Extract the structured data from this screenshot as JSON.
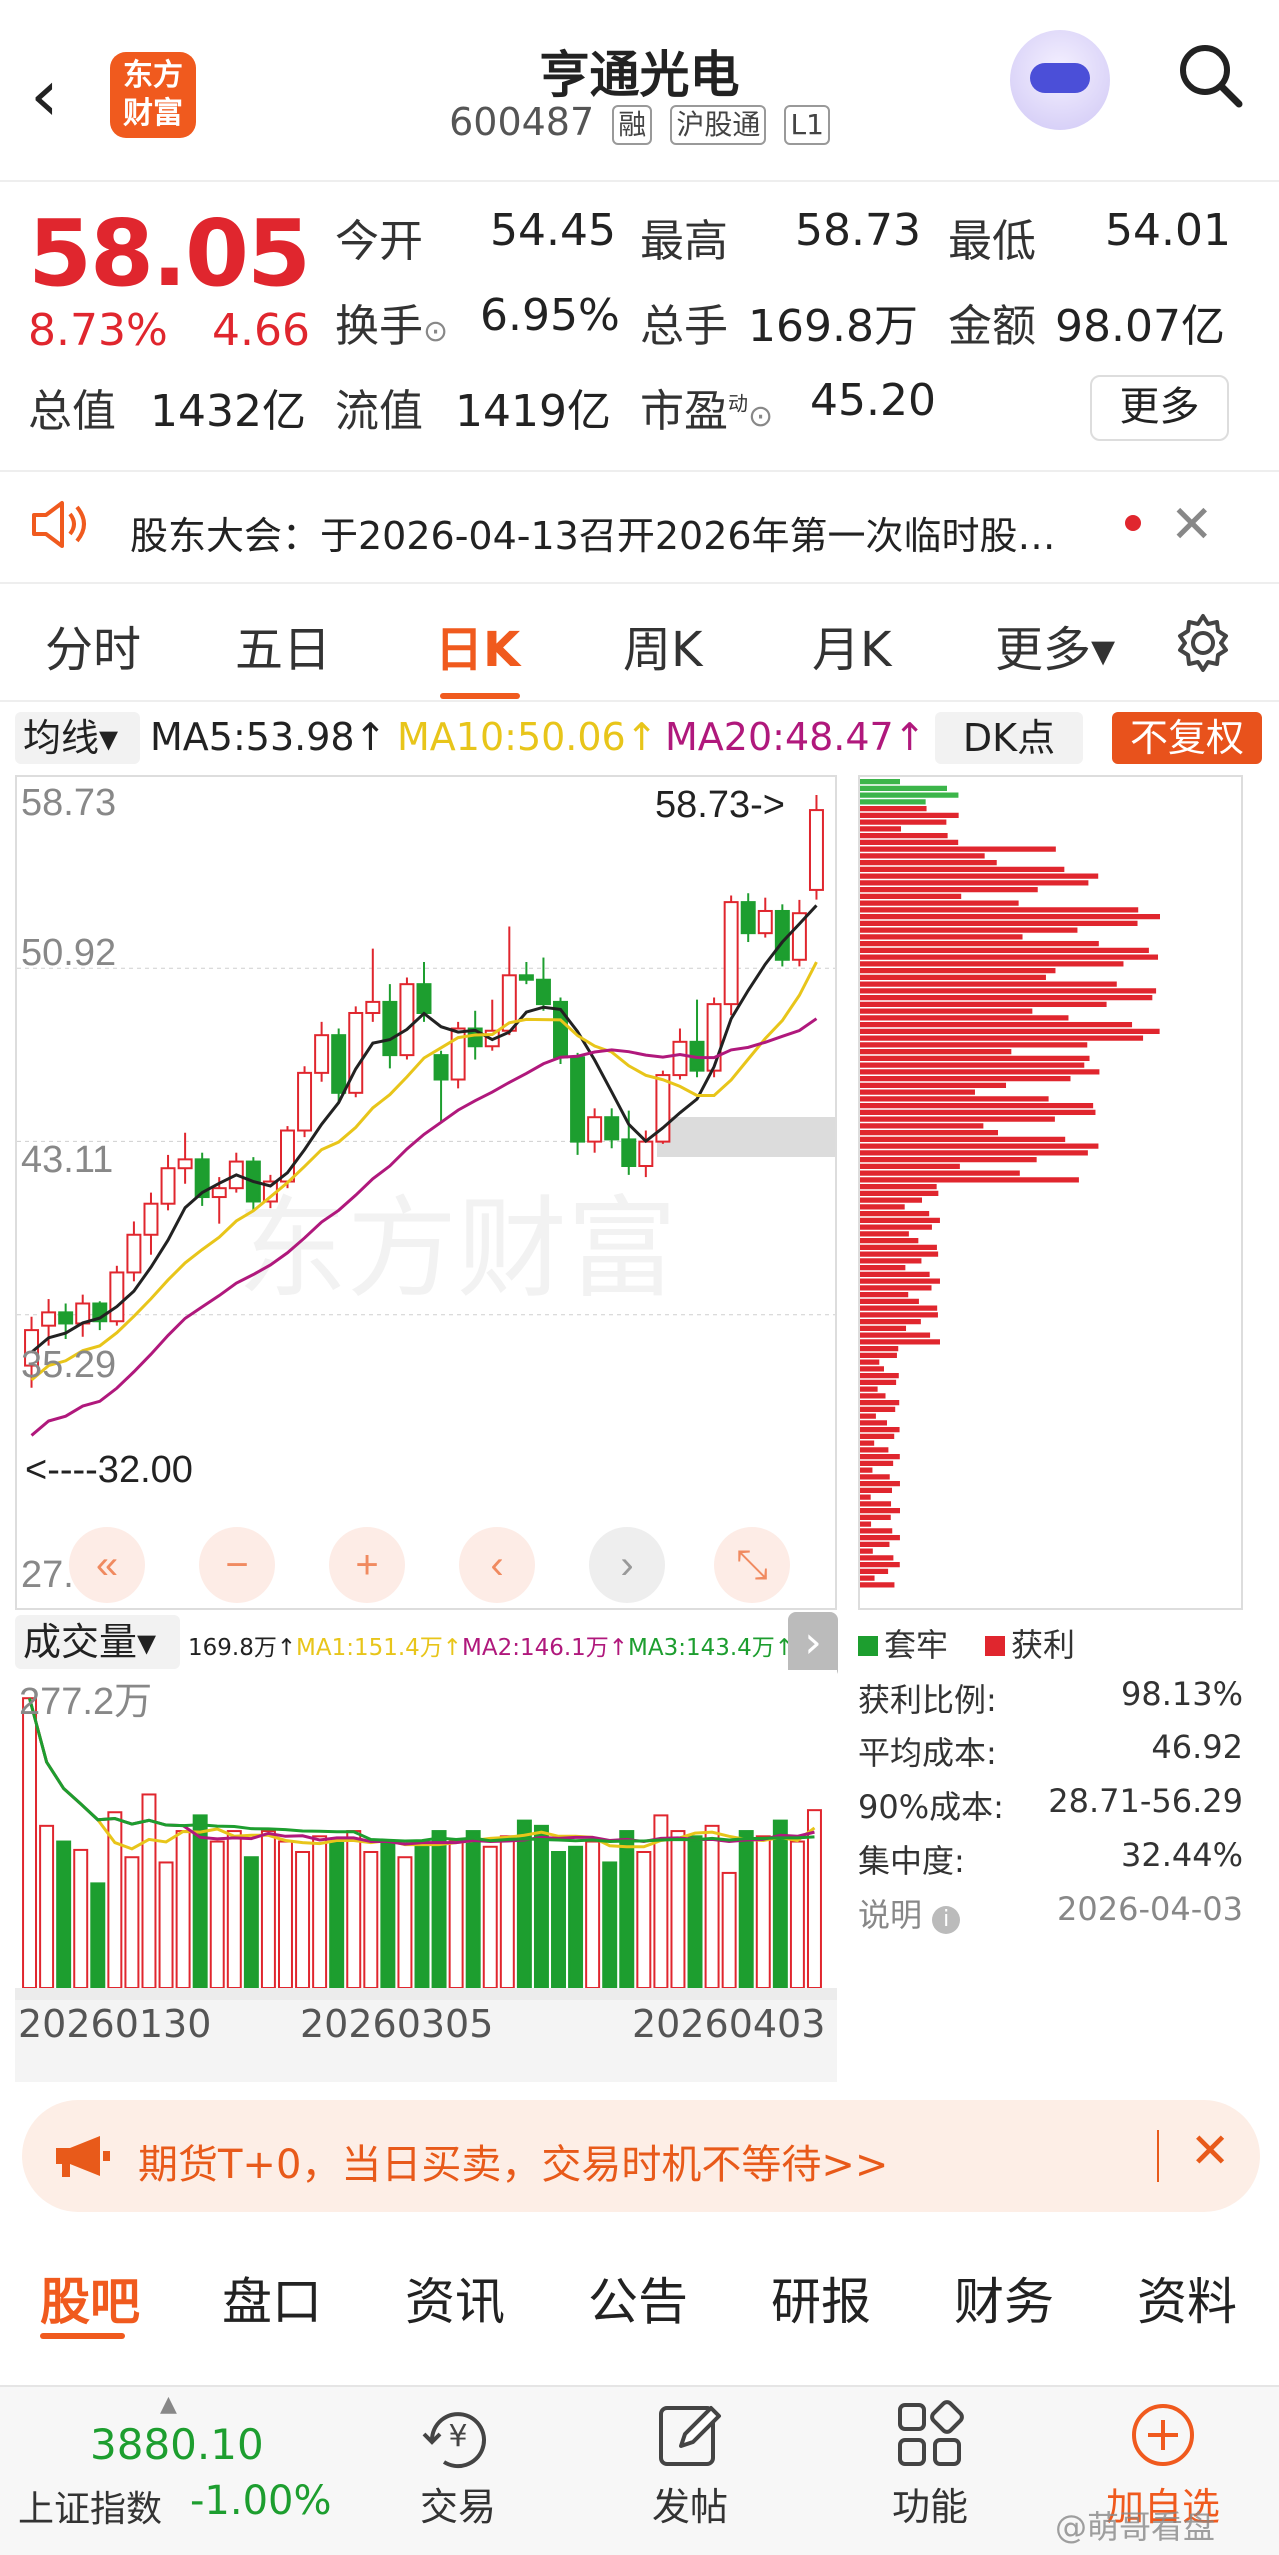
{
  "header": {
    "back_icon": "chevron-left-icon",
    "logo_line1": "东方",
    "logo_line2": "财富",
    "title": "亨通光电",
    "code": "600487",
    "tags": [
      "融",
      "沪股通",
      "L1"
    ],
    "avatar_icon": "robot-avatar-icon",
    "search_icon": "search-icon"
  },
  "quote": {
    "price": "58.05",
    "change_pct": "8.73%",
    "change": "4.66",
    "open_label": "今开",
    "open": "54.45",
    "high_label": "最高",
    "high": "58.73",
    "low_label": "最低",
    "low": "54.01",
    "turnover_label": "换手",
    "turnover": "6.95%",
    "volume_label": "总手",
    "volume": "169.8万",
    "amount_label": "金额",
    "amount": "98.07亿",
    "mktcap_label": "总值",
    "mktcap": "1432亿",
    "float_label": "流值",
    "float": "1419亿",
    "pe_label": "市盈",
    "pe_sup": "动",
    "pe": "45.20",
    "more_label": "更多"
  },
  "notice": {
    "speaker_icon": "speaker-icon",
    "text": "股东大会：于2026-04-13召开2026年第一次临时股…",
    "close_icon": "close-icon"
  },
  "period_tabs": [
    {
      "label": "分时",
      "active": false
    },
    {
      "label": "五日",
      "active": false
    },
    {
      "label": "日K",
      "active": true
    },
    {
      "label": "周K",
      "active": false
    },
    {
      "label": "月K",
      "active": false
    },
    {
      "label": "更多▾",
      "active": false
    }
  ],
  "settings_icon": "gear-icon",
  "ma": {
    "selector": "均线▾",
    "ma5": "MA5:53.98↑",
    "ma10": "MA10:50.06↑",
    "ma20": "MA20:48.47↑",
    "dk": "DK点",
    "adjust": "不复权",
    "colors": {
      "ma5": "#222222",
      "ma10": "#e8c51a",
      "ma20": "#b0187c",
      "up": "#e0262e",
      "down": "#1d9e2f"
    }
  },
  "kline": {
    "price_ticks": [
      "58.73",
      "50.92",
      "43.11",
      "35.29",
      "27.48"
    ],
    "high_marker": "58.73->",
    "low_marker": "<----32.00",
    "watermark": "东方财富",
    "controls": [
      "«",
      "−",
      "+",
      "‹",
      "›",
      "⤡"
    ]
  },
  "chart_data": {
    "type": "candlestick",
    "ylim": [
      27.48,
      58.73
    ],
    "candles": [
      [
        33.0,
        35.2,
        32.0,
        34.6
      ],
      [
        34.8,
        36.0,
        33.9,
        35.4
      ],
      [
        35.4,
        35.8,
        34.2,
        34.9
      ],
      [
        34.9,
        36.2,
        34.3,
        35.8
      ],
      [
        35.8,
        35.9,
        34.6,
        35.0
      ],
      [
        35.0,
        37.5,
        34.8,
        37.2
      ],
      [
        37.2,
        39.5,
        36.8,
        38.9
      ],
      [
        38.9,
        40.8,
        38.0,
        40.3
      ],
      [
        40.3,
        42.5,
        40.0,
        41.9
      ],
      [
        41.9,
        43.5,
        41.2,
        42.3
      ],
      [
        42.3,
        42.6,
        40.2,
        40.6
      ],
      [
        40.6,
        41.5,
        39.4,
        41.0
      ],
      [
        41.0,
        42.6,
        40.8,
        42.2
      ],
      [
        42.2,
        42.4,
        40.0,
        40.4
      ],
      [
        40.4,
        41.6,
        40.1,
        41.3
      ],
      [
        41.3,
        43.8,
        41.0,
        43.6
      ],
      [
        43.6,
        46.5,
        43.3,
        46.2
      ],
      [
        46.2,
        48.5,
        45.8,
        47.9
      ],
      [
        47.9,
        48.2,
        44.8,
        45.3
      ],
      [
        45.3,
        49.2,
        45.1,
        48.9
      ],
      [
        48.9,
        51.8,
        48.5,
        49.4
      ],
      [
        49.4,
        50.2,
        46.4,
        47.0
      ],
      [
        47.0,
        50.5,
        46.8,
        50.2
      ],
      [
        50.2,
        51.2,
        48.5,
        48.9
      ],
      [
        47.0,
        47.2,
        44.0,
        45.9
      ],
      [
        45.9,
        48.5,
        45.5,
        48.2
      ],
      [
        48.2,
        49.0,
        46.8,
        47.4
      ],
      [
        47.4,
        49.5,
        47.2,
        48.1
      ],
      [
        48.1,
        52.8,
        47.9,
        50.6
      ],
      [
        50.6,
        51.2,
        50.2,
        50.4
      ],
      [
        50.4,
        51.4,
        49.0,
        49.3
      ],
      [
        49.4,
        49.6,
        46.6,
        46.9
      ],
      [
        46.9,
        47.1,
        42.5,
        43.1
      ],
      [
        43.1,
        44.6,
        42.6,
        44.2
      ],
      [
        44.2,
        44.6,
        42.8,
        43.2
      ],
      [
        43.2,
        44.5,
        41.6,
        42.0
      ],
      [
        42.0,
        43.6,
        41.5,
        43.1
      ],
      [
        43.1,
        46.3,
        43.0,
        46.1
      ],
      [
        46.1,
        48.2,
        45.9,
        47.6
      ],
      [
        47.6,
        49.5,
        46.0,
        46.3
      ],
      [
        46.3,
        49.6,
        46.0,
        49.3
      ],
      [
        49.3,
        54.2,
        48.8,
        53.9
      ],
      [
        53.9,
        54.3,
        52.1,
        52.5
      ],
      [
        52.5,
        54.1,
        52.3,
        53.5
      ],
      [
        53.5,
        53.8,
        51.0,
        51.3
      ],
      [
        51.3,
        54.0,
        51.0,
        53.4
      ],
      [
        54.45,
        58.73,
        54.01,
        58.05
      ]
    ],
    "ma5_last": 53.98,
    "ma10_last": 50.06,
    "ma20_last": 48.47
  },
  "chip_panel": {
    "legend_trapped": "套牢",
    "legend_profit": "获利",
    "rows": [
      {
        "label": "获利比例:",
        "value": "98.13%"
      },
      {
        "label": "平均成本:",
        "value": "46.92"
      },
      {
        "label": "90%成本:",
        "value": "28.71-56.29"
      },
      {
        "label": "集中度:",
        "value": "32.44%"
      }
    ],
    "note_label": "说明",
    "note_date": "2026-04-03"
  },
  "volume": {
    "selector": "成交量▾",
    "current": "169.8万↑",
    "ma1": "MA1:151.4万↑",
    "ma2": "MA2:146.1万↑",
    "ma3": "MA3:143.4万↑",
    "max_label": "277.2万",
    "dates": [
      "20260130",
      "20260305",
      "20260403"
    ],
    "values": [
      277,
      155,
      140,
      132,
      100,
      168,
      125,
      185,
      120,
      150,
      165,
      140,
      150,
      125,
      150,
      140,
      130,
      145,
      140,
      150,
      130,
      140,
      125,
      140,
      150,
      140,
      150,
      135,
      145,
      160,
      155,
      130,
      135,
      140,
      120,
      150,
      130,
      165,
      150,
      145,
      155,
      110,
      150,
      145,
      160,
      140,
      170
    ]
  },
  "promo": {
    "megaphone_icon": "megaphone-icon",
    "text": "期货T+0，当日买卖，交易时机不等待>>",
    "close_icon": "close-icon"
  },
  "sub_tabs": [
    "股吧",
    "盘口",
    "资讯",
    "公告",
    "研报",
    "财务",
    "资料"
  ],
  "bottom_nav": {
    "index_value": "3880.10",
    "index_name": "上证指数",
    "index_change": "-1.00%",
    "items": [
      {
        "label": "交易",
        "icon": "trade-yen-icon"
      },
      {
        "label": "发帖",
        "icon": "compose-icon"
      },
      {
        "label": "功能",
        "icon": "grid-apps-icon"
      },
      {
        "label": "加自选",
        "icon": "add-circle-icon"
      }
    ],
    "watermark": "@萌哥看盘"
  }
}
